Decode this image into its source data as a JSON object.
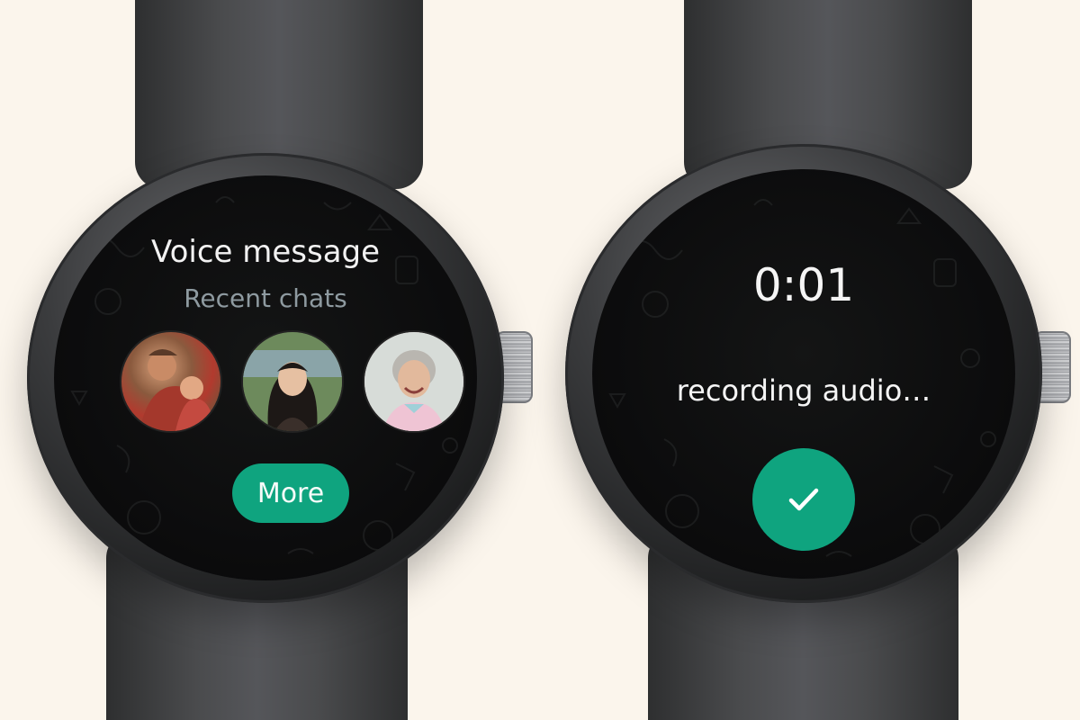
{
  "left_watch": {
    "title": "Voice message",
    "subtitle": "Recent chats",
    "contacts": [
      "contact-1",
      "contact-2",
      "contact-3"
    ],
    "more_label": "More"
  },
  "right_watch": {
    "timer": "0:01",
    "status": "recording audio…",
    "confirm_icon": "checkmark-icon"
  },
  "colors": {
    "background": "#fbf5ec",
    "accent": "#0fa47f",
    "screen": "#0b0b0c",
    "subtitle": "#8e9aa0",
    "text": "#f2f2f2"
  }
}
